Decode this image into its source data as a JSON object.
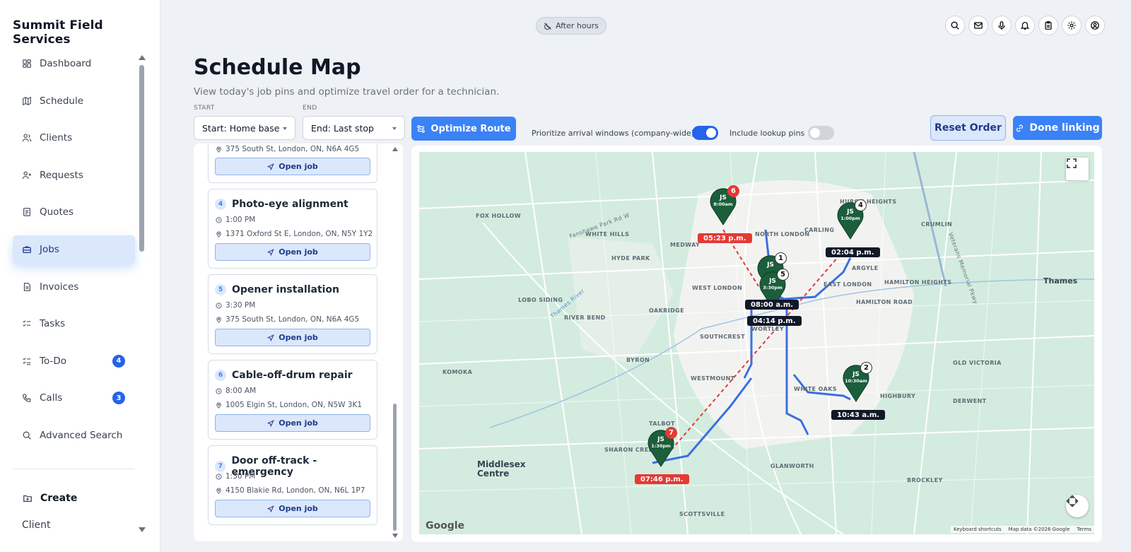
{
  "app": {
    "name": "Summit Field Services"
  },
  "sidebar": {
    "items": [
      {
        "label": "Dashboard",
        "icon": "dashboard-icon"
      },
      {
        "label": "Schedule",
        "icon": "map-icon"
      },
      {
        "label": "Clients",
        "icon": "users-icon"
      },
      {
        "label": "Requests",
        "icon": "user-plus-icon"
      },
      {
        "label": "Quotes",
        "icon": "document-icon"
      },
      {
        "label": "Jobs",
        "icon": "briefcase-icon",
        "active": true
      },
      {
        "label": "Invoices",
        "icon": "invoice-icon"
      },
      {
        "label": "Tasks",
        "icon": "tasks-icon"
      },
      {
        "label": "To-Do",
        "icon": "checklist-icon",
        "badge": "4"
      },
      {
        "label": "Calls",
        "icon": "phone-icon",
        "badge": "3"
      },
      {
        "label": "Advanced Search",
        "icon": "search-icon"
      }
    ],
    "create_label": "Create",
    "client_label": "Client"
  },
  "header": {
    "status_pill": "After hours",
    "icons": [
      "search-icon",
      "mail-icon",
      "microphone-icon",
      "bell-icon",
      "clipboard-icon",
      "gear-icon",
      "account-icon"
    ]
  },
  "page": {
    "title": "Schedule Map",
    "subtitle": "View today's job pins and optimize travel order for a technician."
  },
  "controls": {
    "start_label": "START",
    "start_value": "Start: Home base",
    "end_label": "END",
    "end_value": "End: Last stop",
    "optimize_label": "Optimize Route",
    "prioritize_label": "Prioritize arrival windows (company-wide)",
    "prioritize_on": true,
    "lookup_label": "Include lookup pins",
    "lookup_on": false,
    "reset_label": "Reset Order",
    "done_label": "Done linking"
  },
  "jobs": [
    {
      "num": "3",
      "title": "",
      "time": "",
      "address": "375 South St, London, ON, N6A 4G5",
      "open_label": "Open job",
      "partial": true
    },
    {
      "num": "4",
      "title": "Photo-eye alignment",
      "time": "1:00 PM",
      "address": "1371 Oxford St E, London, ON, N5Y 1Y2",
      "open_label": "Open job"
    },
    {
      "num": "5",
      "title": "Opener installation",
      "time": "3:30 PM",
      "address": "375 South St, London, ON, N6A 4G5",
      "open_label": "Open job"
    },
    {
      "num": "6",
      "title": "Cable-off-drum repair",
      "time": "8:00 AM",
      "address": "1005 Elgin St, London, ON, N5W 3K1",
      "open_label": "Open job"
    },
    {
      "num": "7",
      "title": "Door off-track - emergency",
      "time": "1:30 PM",
      "address": "4150 Blakie Rd, London, ON, N6L 1P7",
      "open_label": "Open job"
    }
  ],
  "map": {
    "places": [
      {
        "name": "FOX HOLLOW"
      },
      {
        "name": "WHITE HILLS"
      },
      {
        "name": "NORTH LONDON"
      },
      {
        "name": "CARLING"
      },
      {
        "name": "HURON HEIGHTS"
      },
      {
        "name": "CRUMLIN"
      },
      {
        "name": "MEDWAY"
      },
      {
        "name": "HYDE PARK"
      },
      {
        "name": "ARGYLE"
      },
      {
        "name": "Thames"
      },
      {
        "name": "EAST LONDON"
      },
      {
        "name": "HAMILTON HEIGHTS"
      },
      {
        "name": "WEST LONDON"
      },
      {
        "name": "HAMILTON ROAD"
      },
      {
        "name": "LOBO SIDING"
      },
      {
        "name": "OAKRIDGE"
      },
      {
        "name": "RIVER BEND"
      },
      {
        "name": "SOUTHCREST"
      },
      {
        "name": "WORTLEY"
      },
      {
        "name": "BYRON"
      },
      {
        "name": "KOMOKA"
      },
      {
        "name": "WESTMOUNT"
      },
      {
        "name": "WHITE OAKS"
      },
      {
        "name": "OLD VICTORIA"
      },
      {
        "name": "HIGHBURY"
      },
      {
        "name": "DERWENT"
      },
      {
        "name": "TALBOT"
      },
      {
        "name": "SHARON CREEK"
      },
      {
        "name": "Middlesex Centre"
      },
      {
        "name": "GLANWORTH"
      },
      {
        "name": "BROCKLEY"
      },
      {
        "name": "SCOTTSVILLE"
      },
      {
        "name": "Thames River"
      },
      {
        "name": "Fanshawe Park Rd W"
      },
      {
        "name": "Veterans Memorial Pkwy"
      }
    ],
    "markers": [
      {
        "initials": "JS",
        "time": "8:00am",
        "num": "6",
        "label": "05:23 p.m.",
        "red": true
      },
      {
        "initials": "JS",
        "time": "1:00pm",
        "num": "4",
        "label": "02:04 p.m.",
        "red": false
      },
      {
        "initials": "JS",
        "time": "",
        "num": "1",
        "label": "08:00 a.m.",
        "red": false
      },
      {
        "initials": "JS",
        "time": "3:30pm",
        "num": "5",
        "label": "04:14 p.m.",
        "red": false
      },
      {
        "initials": "JS",
        "time": "10:30am",
        "num": "2",
        "label": "10:43 a.m.",
        "red": false
      },
      {
        "initials": "JS",
        "time": "1:30pm",
        "num": "7",
        "label": "07:46 p.m.",
        "red": true
      }
    ],
    "google": "Google",
    "attribution": [
      "Keyboard shortcuts",
      "Map data ©2026 Google",
      "Terms"
    ],
    "colors": {
      "route": "#3b6fe0",
      "dashed": "#e53935",
      "marker": "#1b5e3b",
      "label_dark": "#111827",
      "label_red": "#e53935"
    }
  }
}
